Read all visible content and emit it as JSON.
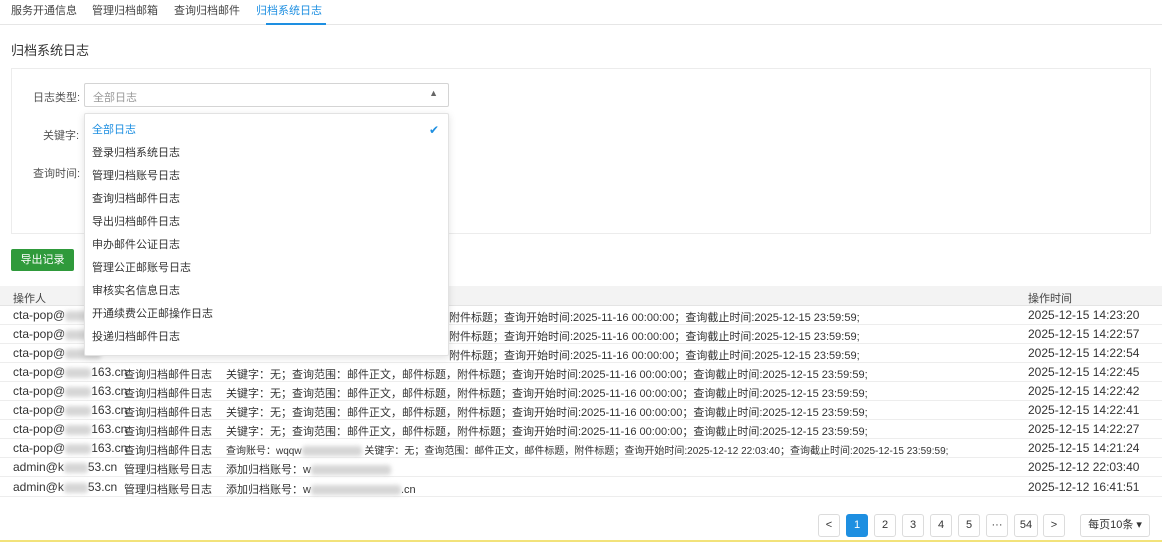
{
  "tabs": [
    "服务开通信息",
    "管理归档邮箱",
    "查询归档邮件",
    "归档系统日志"
  ],
  "page_title": "归档系统日志",
  "filters": {
    "log_type_label": "日志类型:",
    "log_type_value": "全部日志",
    "keyword_label": "关键字:",
    "time_label": "查询时间:"
  },
  "dropdown": {
    "options": [
      "全部日志",
      "登录归档系统日志",
      "管理归档账号日志",
      "查询归档邮件日志",
      "导出归档邮件日志",
      "申办邮件公证日志",
      "管理公正邮账号日志",
      "审核实名信息日志",
      "开通续费公正邮操作日志",
      "投递归档邮件日志"
    ],
    "selected_index": 0
  },
  "export_button": "导出记录",
  "table": {
    "headers": {
      "operator": "操作人",
      "time": "操作时间"
    },
    "rows": [
      {
        "op_a": "cta-pop@",
        "op_b": "",
        "type": "",
        "detail": "附件标题；查询开始时间:2025-11-16 00:00:00；查询截止时间:2025-12-15 23:59:59;",
        "time": "2025-12-15 14:23:20"
      },
      {
        "op_a": "cta-pop@",
        "op_b": "",
        "type": "",
        "detail": "附件标题；查询开始时间:2025-11-16 00:00:00；查询截止时间:2025-12-15 23:59:59;",
        "time": "2025-12-15 14:22:57"
      },
      {
        "op_a": "cta-pop@",
        "op_b": "",
        "type": "",
        "detail": "附件标题；查询开始时间:2025-11-16 00:00:00；查询截止时间:2025-12-15 23:59:59;",
        "time": "2025-12-15 14:22:54"
      },
      {
        "op_a": "cta-pop@",
        "op_b": "163.cn",
        "type": "查询归档邮件日志",
        "detail": "关键字：无；查询范围：邮件正文，邮件标题，附件标题；查询开始时间:2025-11-16 00:00:00；查询截止时间:2025-12-15 23:59:59;",
        "time": "2025-12-15 14:22:45"
      },
      {
        "op_a": "cta-pop@",
        "op_b": "163.cn",
        "type": "查询归档邮件日志",
        "detail": "关键字：无；查询范围：邮件正文，邮件标题，附件标题；查询开始时间:2025-11-16 00:00:00；查询截止时间:2025-12-15 23:59:59;",
        "time": "2025-12-15 14:22:42"
      },
      {
        "op_a": "cta-pop@",
        "op_b": "163.cn",
        "type": "查询归档邮件日志",
        "detail": "关键字：无；查询范围：邮件正文，邮件标题，附件标题；查询开始时间:2025-11-16 00:00:00；查询截止时间:2025-12-15 23:59:59;",
        "time": "2025-12-15 14:22:41"
      },
      {
        "op_a": "cta-pop@",
        "op_b": "163.cn",
        "type": "查询归档邮件日志",
        "detail": "关键字：无；查询范围：邮件正文，邮件标题，附件标题；查询开始时间:2025-11-16 00:00:00；查询截止时间:2025-12-15 23:59:59;",
        "time": "2025-12-15 14:22:27"
      },
      {
        "op_a": "cta-pop@",
        "op_b": "163.cn",
        "type": "查询归档邮件日志",
        "detail": "查询账号：wqqw",
        "detail2": "关键字：无；查询范围：邮件正文，邮件标题，附件标题；查询开始时间:2025-12-12 22:03:40；查询截止时间:2025-12-15 23:59:59;",
        "time": "2025-12-15 14:21:24"
      },
      {
        "op_a": "admin@k",
        "op_b": "53.cn",
        "type": "管理归档账号日志",
        "detail": "添加归档账号：w",
        "time": "2025-12-12 22:03:40"
      },
      {
        "op_a": "admin@k",
        "op_b": "53.cn",
        "type": "管理归档账号日志",
        "detail": "添加归档账号：w",
        "detail2": ".cn",
        "time": "2025-12-12 16:41:51"
      }
    ]
  },
  "pagination": {
    "prev": "<",
    "pages": [
      "1",
      "2",
      "3",
      "4",
      "5"
    ],
    "ellipsis": "···",
    "last": "54",
    "next": ">",
    "page_size": "每页10条 ▾",
    "current": "1"
  },
  "colors": {
    "accent": "#1e8fe1",
    "export_green": "#2f9a3b"
  }
}
